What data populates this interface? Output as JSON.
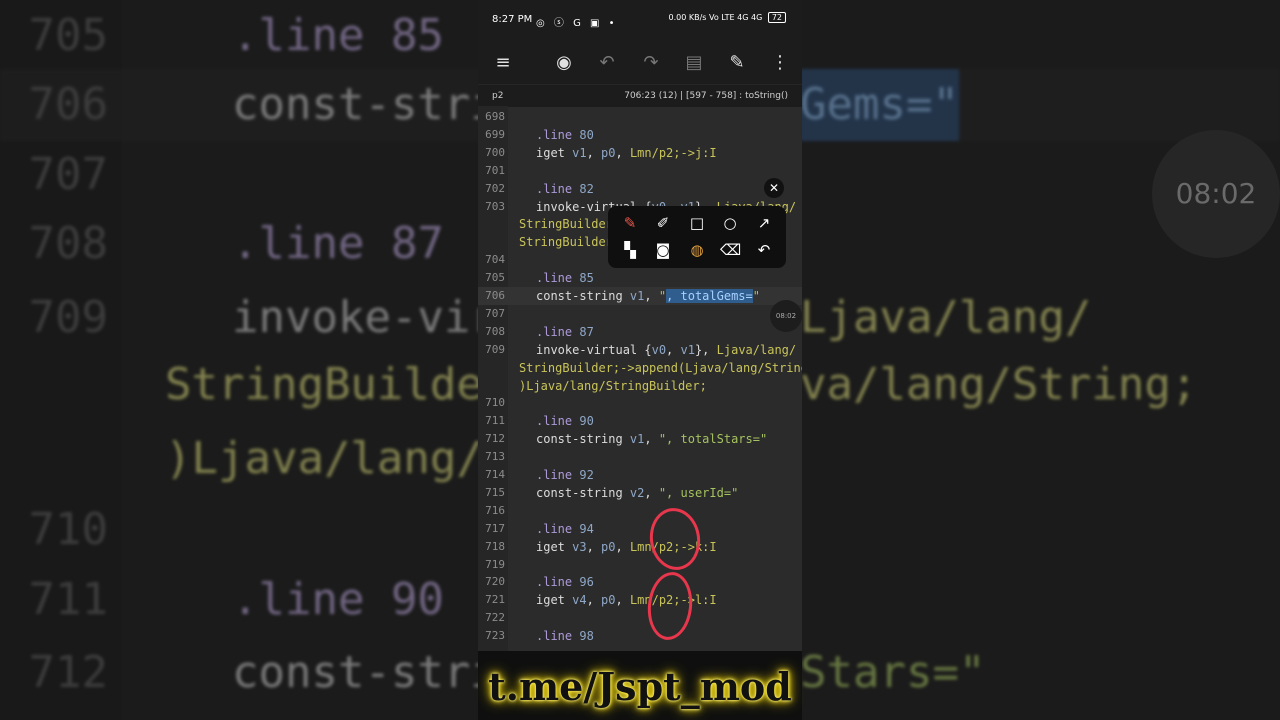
{
  "background": {
    "rows": [
      {
        "num": "705",
        "text": ".line  85",
        "kind": "dir"
      },
      {
        "num": "706",
        "text": "const-strin",
        "kind": "code",
        "right": "Gems=\""
      },
      {
        "num": "707",
        "text": "",
        "kind": "code"
      },
      {
        "num": "708",
        "text": ".line  87",
        "kind": "dir"
      },
      {
        "num": "709",
        "text": "invoke-virtu",
        "kind": "code",
        "right": "Ljava/lang/"
      },
      {
        "num": "",
        "left": "StringBuilder;",
        "right": "va/lang/String;"
      },
      {
        "num": "",
        "left": ")Ljava/lang/S"
      },
      {
        "num": "710",
        "text": "",
        "kind": "code"
      },
      {
        "num": "711",
        "text": ".line  90",
        "kind": "dir"
      },
      {
        "num": "712",
        "text": "const-strin",
        "kind": "code",
        "right": "Stars=\""
      }
    ],
    "timer": "08:02"
  },
  "status_bar": {
    "time": "8:27 PM",
    "indicators": "◎ ⓢ G ▣ •",
    "right": "0.00 KB/s  Vo LTE  4G  4G",
    "battery": "72"
  },
  "toolbar": {
    "menu": "≡",
    "compass": "◉",
    "undo": "↶",
    "redo": "↷",
    "save": "▤",
    "edit": "✎",
    "more": "⋮"
  },
  "subbar": {
    "file": "p2",
    "position": "706:23 (12)  |  [597 - 758] : toString()"
  },
  "editor": {
    "lines": [
      {
        "n": "698",
        "html": ""
      },
      {
        "n": "699",
        "html": "<span class=\"d\">.line</span> <span class=\"n\">80</span>"
      },
      {
        "n": "700",
        "html": "iget <span class=\"n\">v1</span>, <span class=\"n\">p0</span>, <span class=\"ty\">Lmn/p2;-&gt;j:I</span>"
      },
      {
        "n": "701",
        "html": ""
      },
      {
        "n": "702",
        "html": "<span class=\"d\">.line</span> <span class=\"n\">82</span>"
      },
      {
        "n": "703",
        "html": "invoke-virtual {<span class=\"n\">v0</span>, <span class=\"n\">v1</span>}, <span class=\"ty\">Ljava/lang/</span>"
      },
      {
        "n": "",
        "wrap": true,
        "html": "<span class=\"ty\">StringBuilder;-&gt;</span>"
      },
      {
        "n": "",
        "wrap": true,
        "html": "<span class=\"ty\">StringBuilder;</span>"
      },
      {
        "n": "704",
        "html": ""
      },
      {
        "n": "705",
        "html": "<span class=\"d\">.line</span> <span class=\"n\">85</span>"
      },
      {
        "n": "706",
        "cur": true,
        "html": "const-string <span class=\"n\">v1</span>, <span class=\"s\">\"<span class=\"sel\">, totalGems=</span>\"</span>"
      },
      {
        "n": "707",
        "html": ""
      },
      {
        "n": "708",
        "html": "<span class=\"d\">.line</span> <span class=\"n\">87</span>"
      },
      {
        "n": "709",
        "html": "invoke-virtual {<span class=\"n\">v0</span>, <span class=\"n\">v1</span>}, <span class=\"ty\">Ljava/lang/</span>"
      },
      {
        "n": "",
        "wrap": true,
        "html": "<span class=\"ty\">StringBuilder;-&gt;append(Ljava/lang/String;</span>"
      },
      {
        "n": "",
        "wrap": true,
        "html": "<span class=\"ty\">)Ljava/lang/StringBuilder;</span>"
      },
      {
        "n": "710",
        "html": ""
      },
      {
        "n": "711",
        "html": "<span class=\"d\">.line</span> <span class=\"n\">90</span>"
      },
      {
        "n": "712",
        "html": "const-string <span class=\"n\">v1</span>, <span class=\"s\">\", totalStars=\"</span>"
      },
      {
        "n": "713",
        "html": ""
      },
      {
        "n": "714",
        "html": "<span class=\"d\">.line</span> <span class=\"n\">92</span>"
      },
      {
        "n": "715",
        "html": "const-string <span class=\"n\">v2</span>, <span class=\"s\">\", userId=\"</span>"
      },
      {
        "n": "716",
        "html": ""
      },
      {
        "n": "717",
        "html": "<span class=\"d\">.line</span> <span class=\"n\">94</span>"
      },
      {
        "n": "718",
        "html": "iget <span class=\"n\">v3</span>, <span class=\"n\">p0</span>, <span class=\"ty\">Lmn/p2;-&gt;k:I</span>"
      },
      {
        "n": "719",
        "html": ""
      },
      {
        "n": "720",
        "html": "<span class=\"d\">.line</span> <span class=\"n\">96</span>"
      },
      {
        "n": "721",
        "html": "iget <span class=\"n\">v4</span>, <span class=\"n\">p0</span>, <span class=\"ty\">Lmn/p2;-&gt;l:I</span>"
      },
      {
        "n": "722",
        "html": ""
      },
      {
        "n": "723",
        "html": "<span class=\"d\">.line</span> <span class=\"n\">98</span>"
      }
    ]
  },
  "annotation_tools": {
    "close": "✕",
    "brush": "✎",
    "highlighter": "✐",
    "rectangle": "□",
    "circle": "○",
    "arrow": "↗",
    "mosaic": "▚",
    "camera": "◙",
    "color": "◍",
    "eraser": "⌫",
    "undo": "↶"
  },
  "timer_chip": "08:02",
  "banner_text": "t.me/Jspt_mod",
  "colors": {
    "accent_red": "#e8374c",
    "selection": "#2e5d8e",
    "banner_glow": "#ffe500"
  }
}
